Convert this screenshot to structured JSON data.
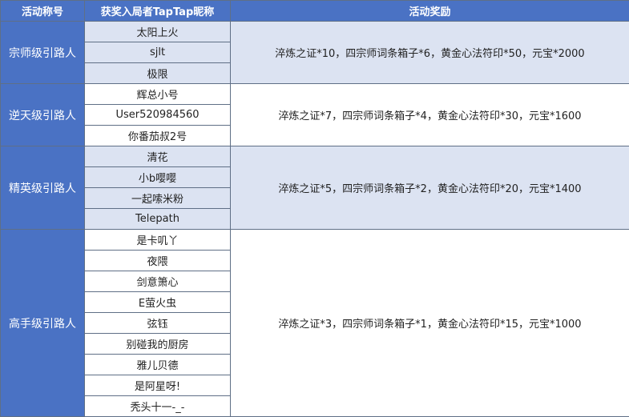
{
  "headers": {
    "col1": "活动称号",
    "col2": "获奖入局者TapTap昵称",
    "col3": "活动奖励"
  },
  "groups": [
    {
      "title": "宗师级引路人",
      "names": [
        "太阳上火",
        "sjlt",
        "极限"
      ],
      "reward": "淬炼之证*10，四宗师词条箱子*6，黄金心法符印*50，元宝*2000"
    },
    {
      "title": "逆天级引路人",
      "names": [
        "辉总小号",
        "User520984560",
        "你番茄叔2号"
      ],
      "reward": "淬炼之证*7，四宗师词条箱子*4，黄金心法符印*30，元宝*1600"
    },
    {
      "title": "精英级引路人",
      "names": [
        "清花",
        "小b嘤嘤",
        "一起嗦米粉",
        "Telepath"
      ],
      "reward": "淬炼之证*5，四宗师词条箱子*2，黄金心法符印*20，元宝*1400"
    },
    {
      "title": "高手级引路人",
      "names": [
        "是卡叽丫",
        "夜隈",
        "剑意箫心",
        "E萤火虫",
        "弦钰",
        "别碰我的厨房",
        "雅儿贝德",
        "是阿星呀!",
        "秃头十一-_-"
      ],
      "reward": "淬炼之证*3，四宗师词条箱子*1，黄金心法符印*15，元宝*1000"
    }
  ]
}
